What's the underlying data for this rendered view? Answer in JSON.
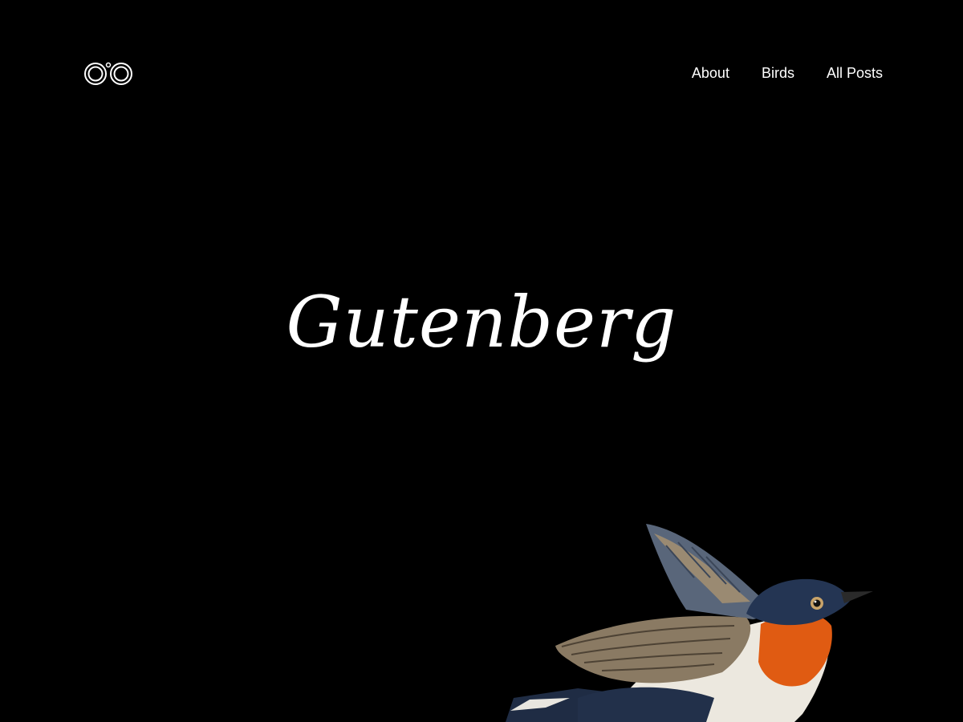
{
  "site": {
    "logo_icon": "binoculars-icon"
  },
  "nav": {
    "items": [
      {
        "label": "About"
      },
      {
        "label": "Birds"
      },
      {
        "label": "All Posts"
      }
    ]
  },
  "hero": {
    "title": "Gutenberg"
  },
  "illustration": {
    "subject": "flying-bird-illustration"
  },
  "colors": {
    "background": "#000000",
    "text": "#ffffff",
    "bird_throat": "#e05b12",
    "bird_head": "#243553",
    "bird_wing": "#8a7a63"
  }
}
